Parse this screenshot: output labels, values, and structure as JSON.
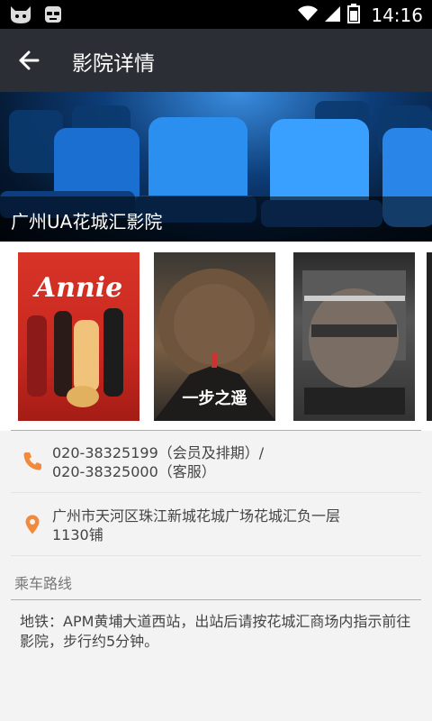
{
  "status_bar": {
    "time": "14:16",
    "icons": [
      "cat-face-icon",
      "glasses-face-icon",
      "wifi-icon",
      "signal-icon",
      "battery-icon"
    ]
  },
  "app_bar": {
    "back_icon": "arrow-left-icon",
    "title": "影院详情"
  },
  "banner": {
    "cinema_name": "广州UA花城汇影院"
  },
  "posters": [
    {
      "title": "Annie"
    },
    {
      "title": "一步之遥"
    },
    {
      "title": ""
    }
  ],
  "contact": {
    "phone_icon": "phone-icon",
    "phone_line1": "020-38325199（会员及排期）/",
    "phone_line2": "020-38325000（客服）",
    "location_icon": "location-pin-icon",
    "address": "广州市天河区珠江新城花城广场花城汇负一层1130铺"
  },
  "route": {
    "label": "乘车路线",
    "text": "地铁：APM黄埔大道西站，出站后请按花城汇商场内指示前往影院，步行约5分钟。"
  },
  "colors": {
    "accent": "#f08a3e",
    "app_bar": "#2b2f35",
    "divider": "#e8a15a"
  }
}
